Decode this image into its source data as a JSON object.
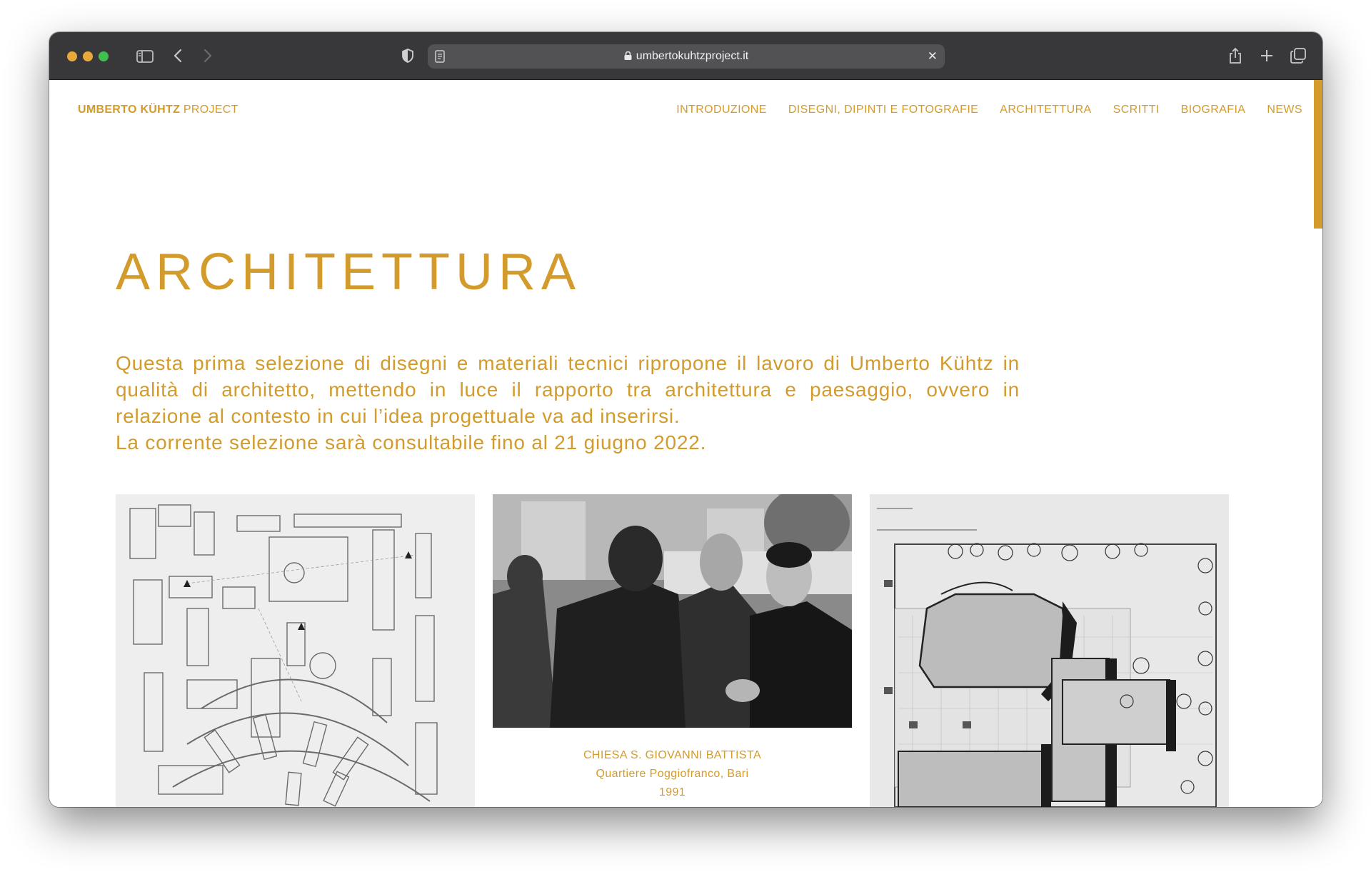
{
  "browser": {
    "url": "umbertokuhtzproject.it"
  },
  "header": {
    "brand_bold": "UMBERTO KÜHTZ",
    "brand_light": "PROJECT",
    "nav": [
      {
        "label": "INTRODUZIONE"
      },
      {
        "label": "DISEGNI, DIPINTI E FOTOGRAFIE"
      },
      {
        "label": "ARCHITETTURA"
      },
      {
        "label": "SCRITTI"
      },
      {
        "label": "BIOGRAFIA"
      },
      {
        "label": "NEWS"
      }
    ]
  },
  "main": {
    "title": "ARCHITETTURA",
    "intro": "Questa prima selezione di disegni e materiali tecnici ripropone il lavoro di Umberto Kühtz in qualità di architetto, mettendo in luce il rapporto tra architettura e paesaggio, ovvero in relazione al contesto in cui l’idea progettuale va ad inserirsi.",
    "intro_note": "La corrente selezione sarà consultabile fino al 21 giugno 2022.",
    "gallery": {
      "caption_title": "CHIESA S. GIOVANNI BATTISTA",
      "caption_place": "Quartiere Poggiofranco, Bari",
      "caption_year": "1991"
    }
  },
  "colors": {
    "accent": "#d39b2b",
    "toolbar": "#38383a"
  },
  "icons": [
    "sidebar-icon",
    "chevron-left-icon",
    "chevron-right-icon",
    "shield-icon",
    "reader-icon",
    "lock-icon",
    "close-icon",
    "share-icon",
    "plus-icon",
    "tabs-icon"
  ]
}
